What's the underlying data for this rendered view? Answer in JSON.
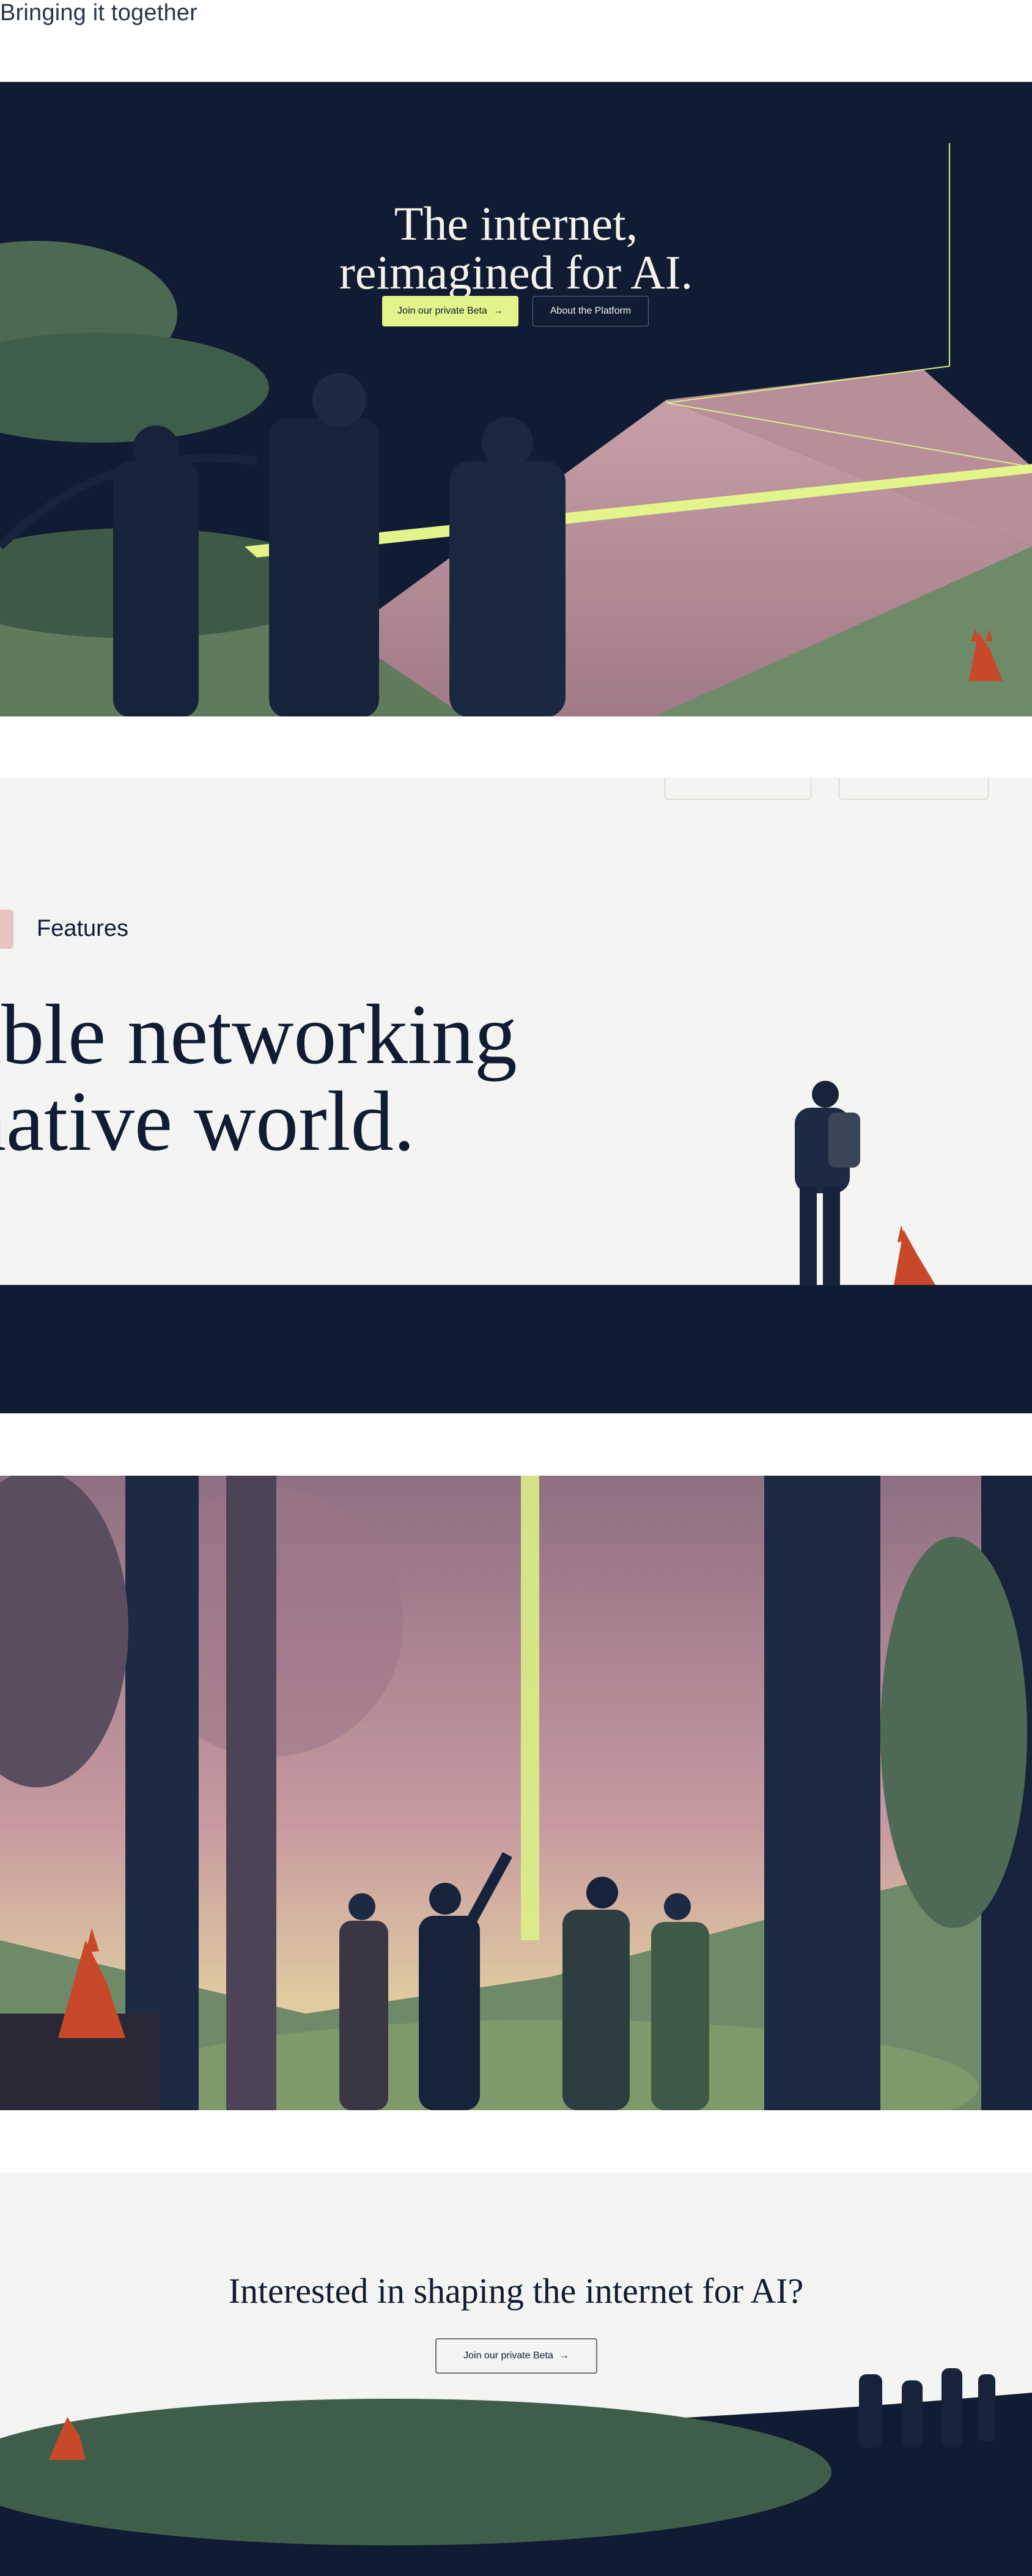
{
  "top_label": "Bringing it together",
  "hero": {
    "title_line1": "The internet,",
    "title_line2": "reimagined for AI.",
    "primary_button": "Join our private Beta",
    "secondary_button": "About the Platform",
    "arrow": "→"
  },
  "features": {
    "label": "Features",
    "heading_line1": "able networking",
    "heading_line2": "native world."
  },
  "cta": {
    "title": "Interested in shaping the internet for AI?",
    "button": "Join our private Beta",
    "arrow": "→"
  },
  "colors": {
    "navy": "#0f1c33",
    "accent_lime": "#e2f48a",
    "mauve": "#b48a96",
    "green": "#6f8a68",
    "fox": "#c8482a",
    "page_bg": "#f4f4f2"
  },
  "icons": [
    "arrow-right-icon",
    "fox-illustration",
    "people-illustration"
  ]
}
